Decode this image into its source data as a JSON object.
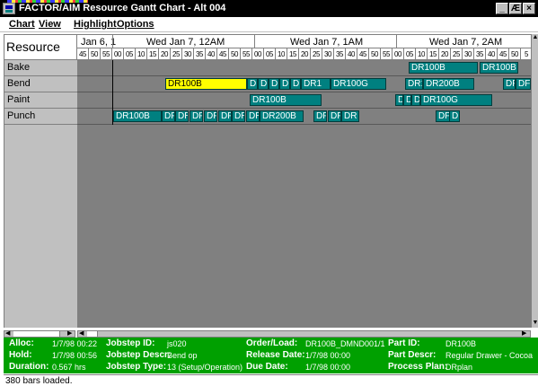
{
  "window": {
    "title": "FACTOR/AIM Resource Gantt Chart - Alt 004",
    "buttons": [
      "_",
      "Æ",
      "×"
    ]
  },
  "menu": [
    {
      "label": "Chart"
    },
    {
      "label": "View"
    },
    {
      "label": "Highlight"
    },
    {
      "label": "Options"
    }
  ],
  "resource_header": "Resource",
  "resources": [
    "Bake",
    "Bend",
    "Paint",
    "Punch"
  ],
  "timeline": {
    "dates": [
      "Jan 6, 1",
      "Wed Jan 7, 12AM",
      "Wed Jan 7, 1AM",
      "Wed Jan 7, 2AM"
    ],
    "ticks": [
      "45",
      "50",
      "55",
      "00",
      "05",
      "10",
      "15",
      "20",
      "25",
      "30",
      "35",
      "40",
      "45",
      "50",
      "55",
      "00",
      "05",
      "10",
      "15",
      "20",
      "25",
      "30",
      "35",
      "40",
      "45",
      "50",
      "55",
      "00",
      "05",
      "10",
      "15",
      "20",
      "25",
      "30",
      "35",
      "40",
      "45",
      "50",
      "5"
    ]
  },
  "bars": [
    {
      "row": 0,
      "label": "DR100B",
      "selected": false
    },
    {
      "row": 0,
      "label": "DR100B",
      "selected": false
    },
    {
      "row": 1,
      "label": "DR100B",
      "selected": true
    },
    {
      "row": 1,
      "label": "DI",
      "selected": false
    },
    {
      "row": 1,
      "label": "DF",
      "selected": false
    },
    {
      "row": 1,
      "label": "DF",
      "selected": false
    },
    {
      "row": 1,
      "label": "DF",
      "selected": false
    },
    {
      "row": 1,
      "label": "DR",
      "selected": false
    },
    {
      "row": 1,
      "label": "DR1",
      "selected": false
    },
    {
      "row": 1,
      "label": "DR100G",
      "selected": false
    },
    {
      "row": 1,
      "label": "DR1",
      "selected": false
    },
    {
      "row": 1,
      "label": "DR200B",
      "selected": false
    },
    {
      "row": 1,
      "label": "DF",
      "selected": false
    },
    {
      "row": 1,
      "label": "DF",
      "selected": false
    },
    {
      "row": 2,
      "label": "DR100B",
      "selected": false
    },
    {
      "row": 2,
      "label": "DI",
      "selected": false
    },
    {
      "row": 2,
      "label": "DI",
      "selected": false
    },
    {
      "row": 2,
      "label": "DI",
      "selected": false
    },
    {
      "row": 2,
      "label": "DR100G",
      "selected": false
    },
    {
      "row": 3,
      "label": "DR100B",
      "selected": false
    },
    {
      "row": 3,
      "label": "DF",
      "selected": false
    },
    {
      "row": 3,
      "label": "DR",
      "selected": false
    },
    {
      "row": 3,
      "label": "DF",
      "selected": false
    },
    {
      "row": 3,
      "label": "DF",
      "selected": false
    },
    {
      "row": 3,
      "label": "DF",
      "selected": false
    },
    {
      "row": 3,
      "label": "DR",
      "selected": false
    },
    {
      "row": 3,
      "label": "DR",
      "selected": false
    },
    {
      "row": 3,
      "label": "DR200B",
      "selected": false
    },
    {
      "row": 3,
      "label": "DF",
      "selected": false
    },
    {
      "row": 3,
      "label": "DF",
      "selected": false
    },
    {
      "row": 3,
      "label": "DR",
      "selected": false
    },
    {
      "row": 3,
      "label": "DF",
      "selected": false
    },
    {
      "row": 3,
      "label": "DF",
      "selected": false
    }
  ],
  "info": {
    "alloc_label": "Alloc:",
    "alloc_value": "1/7/98 00:22",
    "hold_label": "Hold:",
    "hold_value": "1/7/98 00:56",
    "duration_label": "Duration:",
    "duration_value": "0.567 hrs",
    "jobstep_id_label": "Jobstep ID:",
    "jobstep_id_value": "js020",
    "jobstep_descr_label": "Jobstep Descr:",
    "jobstep_descr_value": "Bend op",
    "jobstep_type_label": "Jobstep Type:",
    "jobstep_type_value": "13 (Setup/Operation)",
    "order_label": "Order/Load:",
    "order_value": "DR100B_DMND001/1",
    "release_label": "Release Date:",
    "release_value": "1/7/98 00:00",
    "due_label": "Due Date:",
    "due_value": "1/7/98 00:00",
    "part_id_label": "Part ID:",
    "part_id_value": "DR100B",
    "part_descr_label": "Part Descr:",
    "part_descr_value": "Regular Drawer - Cocoa",
    "plan_label": "Process Plan:",
    "plan_value": "DRplan"
  },
  "status": "380 bars loaded.",
  "colors": {
    "bar": "#008080",
    "selected_bar": "#ffff00",
    "info_panel": "#00a000",
    "chart_bg": "#808080"
  }
}
